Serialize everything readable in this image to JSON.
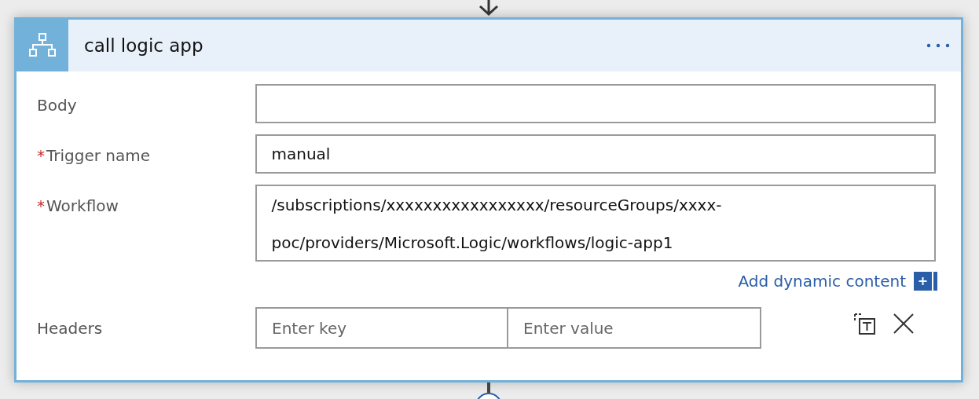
{
  "card": {
    "title": "call logic app"
  },
  "fields": [
    {
      "kind": "text",
      "label": "Body"
    },
    {
      "kind": "text",
      "label": "Trigger name",
      "required_mark": "*",
      "value": "manual"
    },
    {
      "kind": "multiline",
      "label": "Workflow",
      "required_mark": "*",
      "value": "/subscriptions/xxxxxxxxxxxxxxxxx/resourceGroups/xxxx-poc/providers/Microsoft.Logic/workflows/logic-app1",
      "link": "Add dynamic content"
    },
    {
      "kind": "keyvalue",
      "label": "Headers",
      "key_placeholder": "Enter key",
      "value_placeholder": "Enter value"
    }
  ]
}
